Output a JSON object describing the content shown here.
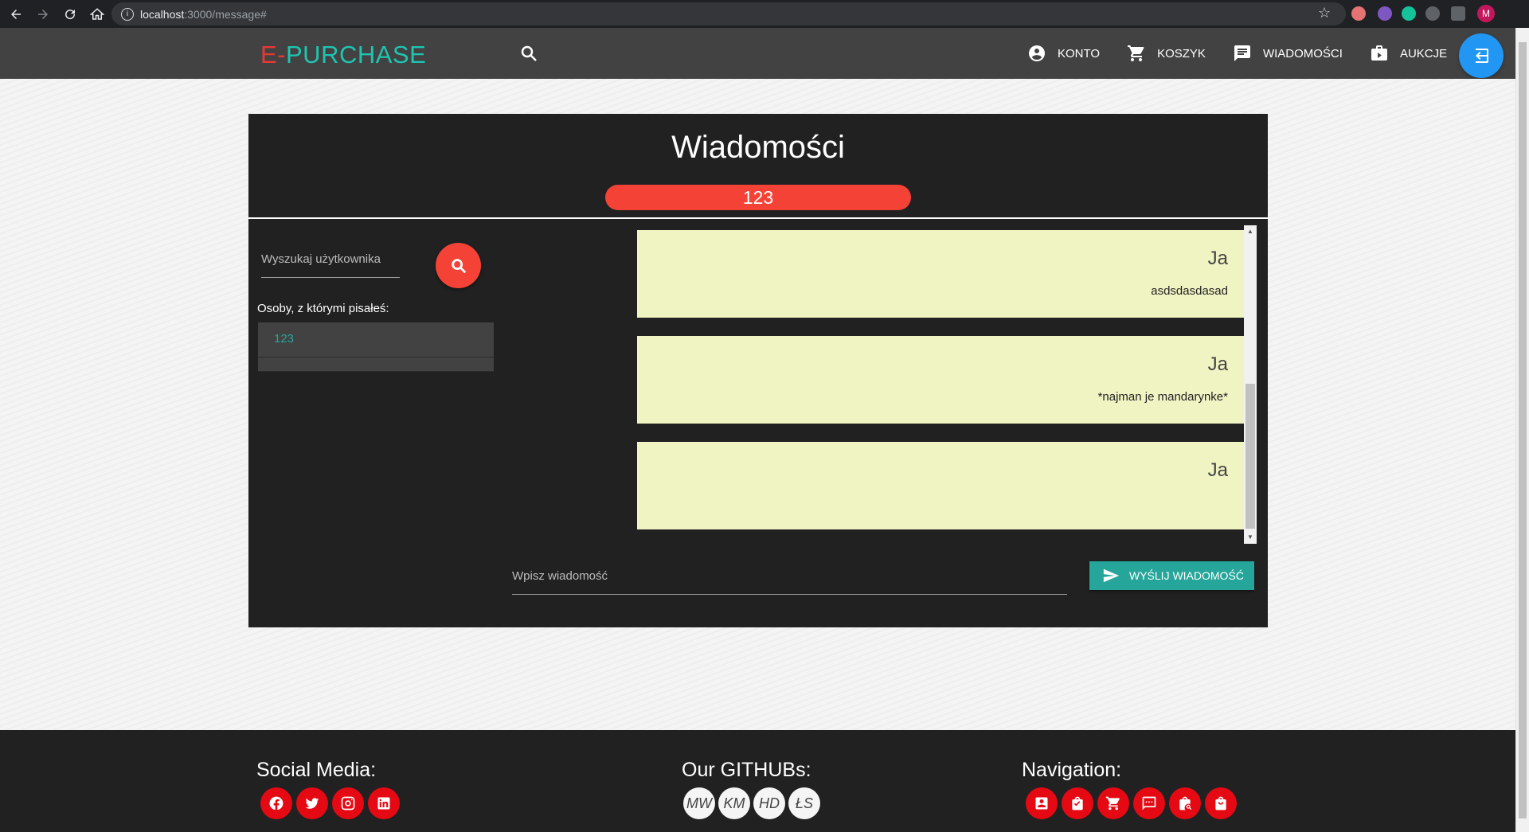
{
  "browser": {
    "url_host": "localhost",
    "url_rest": ":3000/message#",
    "profile_initial": "M"
  },
  "navbar": {
    "brand_e": "E-",
    "brand_rest": "PURCHASE",
    "items": [
      {
        "label": "KONTO",
        "icon": "account-circle-icon"
      },
      {
        "label": "KOSZYK",
        "icon": "cart-icon"
      },
      {
        "label": "WIADOMOŚCI",
        "icon": "message-icon"
      },
      {
        "label": "AUKCJE",
        "icon": "auction-icon"
      }
    ]
  },
  "card": {
    "title": "Wiadomości",
    "active_user": "123",
    "search_placeholder": "Wyszukaj użytkownika",
    "people_label": "Osoby, z którymi pisałeś:",
    "people": [
      "123"
    ],
    "messages": [
      {
        "author": "Ja",
        "text": "asdsdasdasad"
      },
      {
        "author": "Ja",
        "text": "*najman je mandarynke*"
      },
      {
        "author": "Ja",
        "text": ""
      }
    ],
    "message_placeholder": "Wpisz wiadomość",
    "send_label": "WYŚLIJ WIADOMOŚĆ"
  },
  "footer": {
    "social_title": "Social Media:",
    "github_title": "Our GITHUBs:",
    "nav_title": "Navigation:",
    "social_icons": [
      "facebook-icon",
      "twitter-icon",
      "instagram-icon",
      "linkedin-icon"
    ],
    "githubs": [
      "MW",
      "KM",
      "HD",
      "ŁS"
    ],
    "nav_icons": [
      "account-icon",
      "orders-icon",
      "cart-icon",
      "messages-icon",
      "search-auction-icon",
      "shop-icon"
    ]
  },
  "colors": {
    "accent_red": "#f44336",
    "teal": "#26a69a",
    "message_bg": "#f0f4c3",
    "fab_blue": "#2196f3"
  }
}
